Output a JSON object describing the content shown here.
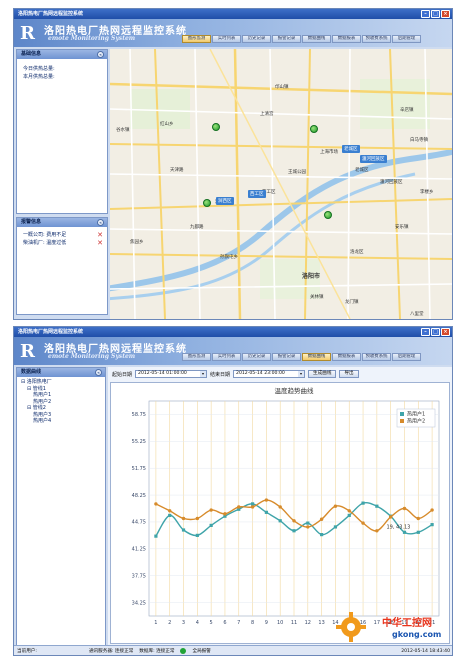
{
  "screen1": {
    "window_title": "洛阳热电厂热网远程监控系统",
    "app_title": "洛阳热电厂热网远程监控系统",
    "app_subtitle": "emote Monitoring System",
    "logo_letter": "R",
    "nav": [
      "图形监测",
      "实时列表",
      "历史记录",
      "报警记录",
      "数据曲线",
      "数据报表",
      "预收费系统",
      "后期管理"
    ],
    "active_nav": 0,
    "info_panel": {
      "title": "基础信息",
      "lines": [
        "今日供热总量:",
        "本月供热总量:"
      ]
    },
    "alarm_panel": {
      "title": "报警信息",
      "items": [
        "一概公司: 费用不足",
        "柴油机厂: 温度过低"
      ]
    },
    "map": {
      "labels": [
        "洛阳市",
        "老城区",
        "西工区",
        "涧西区",
        "瀍河回族区",
        "孙旗屯乡",
        "邙山镇",
        "上清宫",
        "辛店镇",
        "安乐镇",
        "龙门镇",
        "关林镇",
        "李楼乡",
        "白马寺镇",
        "谷水镇",
        "红山乡",
        "洛龙区",
        "王城公园",
        "上海市场",
        "九都路",
        "天津路",
        "八里堂",
        "焦园乡"
      ],
      "badges": [
        "老城区",
        "瀍河回族区",
        "西工区",
        "涧西区"
      ]
    }
  },
  "screen2": {
    "window_title": "洛阳热电厂热网远程监控系统",
    "app_title": "洛阳热电厂热网远程监控系统",
    "app_subtitle": "emote Monitoring System",
    "logo_letter": "R",
    "nav": [
      "图形监测",
      "实时列表",
      "历史记录",
      "报警记录",
      "数据曲线",
      "数据报表",
      "预收费系统",
      "后期管理"
    ],
    "active_nav": 4,
    "tree_panel_title": "数据曲线",
    "tree": [
      {
        "label": "洛阳热电厂",
        "level": 0
      },
      {
        "label": "管线1",
        "level": 1
      },
      {
        "label": "热用户1",
        "level": 2
      },
      {
        "label": "热用户2",
        "level": 2
      },
      {
        "label": "管线2",
        "level": 1
      },
      {
        "label": "热用户3",
        "level": 2
      },
      {
        "label": "热用户4",
        "level": 2
      }
    ],
    "filters": {
      "start_label": "起始日期",
      "start_value": "2012-05-14 01:00:00",
      "end_label": "结束日期",
      "end_value": "2012-05-14 23:00:00",
      "generate_button": "生成曲线",
      "export_button": "导出"
    },
    "statusbar": {
      "user": "当前用户:",
      "comm": "通讯服务器: 连接正常",
      "db": "数据库: 连接正常",
      "alarm": "全局报警",
      "time": "2012-05-14 18:43:40"
    }
  },
  "chart_data": {
    "type": "line",
    "title": "温度趋势曲线",
    "xlabel": "",
    "ylabel": "",
    "x": [
      1,
      2,
      3,
      4,
      5,
      6,
      7,
      8,
      9,
      10,
      11,
      12,
      13,
      14,
      15,
      16,
      17,
      18,
      19,
      20,
      21
    ],
    "series": [
      {
        "name": "热用户1",
        "color": "#3fa4a9",
        "values": [
          42.9,
          45.6,
          43.7,
          43.0,
          44.3,
          45.5,
          46.4,
          47.1,
          46.0,
          44.9,
          43.6,
          44.6,
          43.1,
          44.1,
          45.6,
          47.2,
          46.8,
          45.5,
          43.4,
          43.4,
          44.4
        ]
      },
      {
        "name": "热用户2",
        "color": "#d78b2b",
        "values": [
          47.1,
          46.2,
          45.2,
          45.2,
          46.3,
          45.8,
          46.7,
          46.7,
          47.6,
          46.7,
          44.9,
          44.1,
          45.1,
          46.8,
          46.2,
          44.6,
          43.6,
          45.4,
          46.5,
          45.2,
          46.3
        ]
      }
    ],
    "yticks": [
      "34.25",
      "37.75",
      "41.25",
      "44.75",
      "48.25",
      "51.75",
      "55.25",
      "58.75"
    ],
    "ylim": [
      32.5,
      60.5
    ],
    "annotation": "19, 43.13",
    "grid": true,
    "legend": "top-right"
  },
  "watermark": {
    "brand": "中华工控网",
    "url": "gkong.com"
  }
}
